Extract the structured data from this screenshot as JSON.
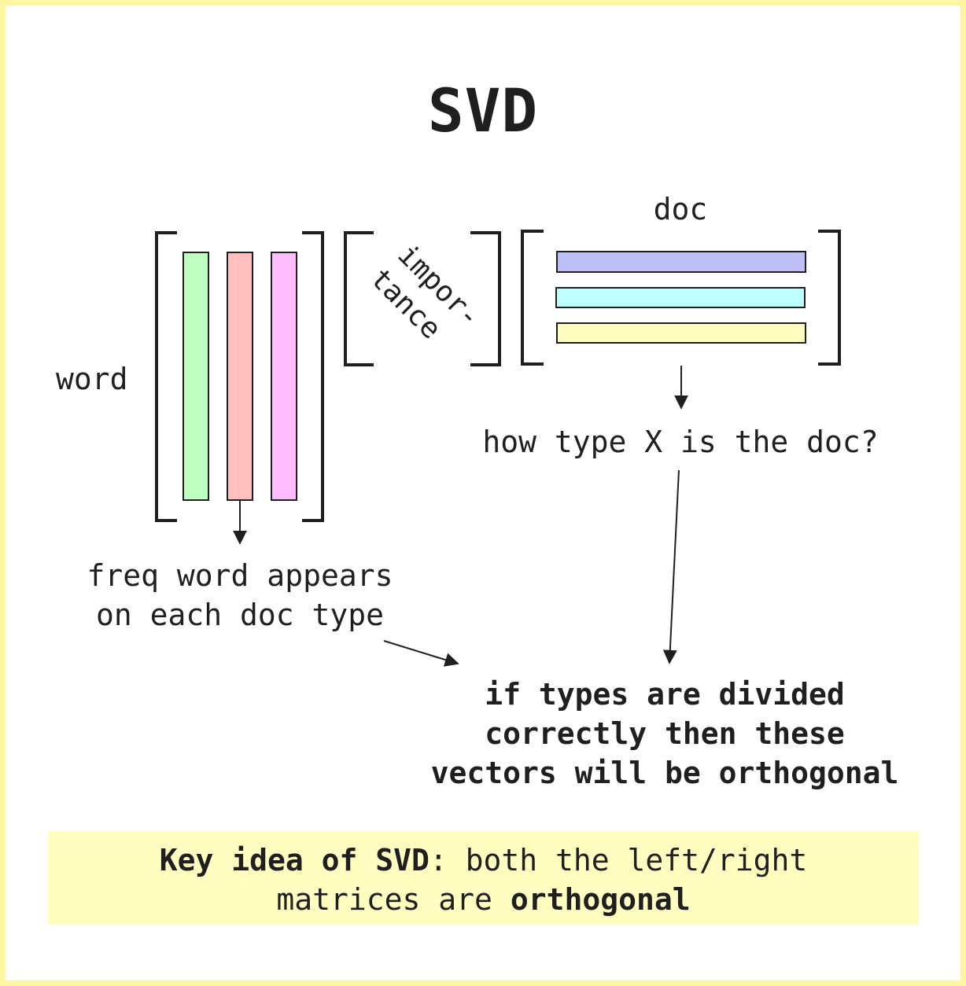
{
  "title": "SVD",
  "labels": {
    "word": "word",
    "doc": "doc",
    "importance_line1": "impor-",
    "importance_line2": "tance",
    "freq_line1": "freq word appears",
    "freq_line2": "on each doc type",
    "how_type": "how type X is the doc?",
    "orthogonal_line1": "if types are divided",
    "orthogonal_line2": "correctly then these",
    "orthogonal_line3": "vectors will be orthogonal"
  },
  "key_idea": {
    "bold_prefix": "Key idea of SVD",
    "text_mid": ": both the left/right",
    "text_line2": "matrices are ",
    "bold_suffix": "orthogonal"
  },
  "colors": {
    "frame": "#fff5a0",
    "key_box": "#fffdc0",
    "col_green": "#bfffc4",
    "col_red": "#ffbfbf",
    "col_pink": "#ffbfff",
    "row_blue": "#bfbff8",
    "row_cyan": "#bfffff",
    "row_yellow": "#fffdc0"
  }
}
